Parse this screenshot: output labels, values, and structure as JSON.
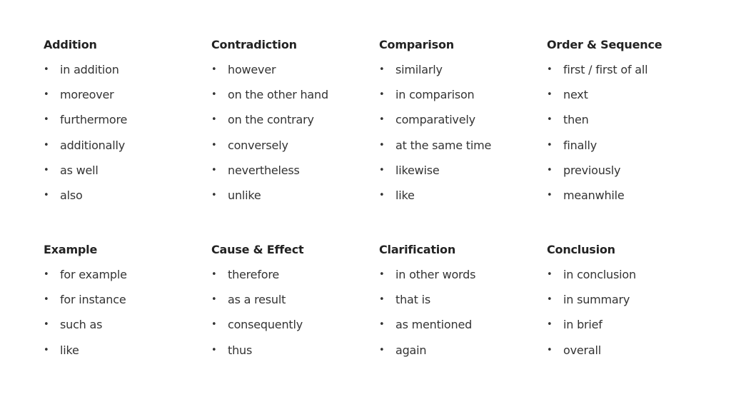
{
  "groups": [
    {
      "title": "Addition",
      "items": [
        "in addition",
        "moreover",
        "furthermore",
        "additionally",
        "as well",
        "also"
      ]
    },
    {
      "title": "Contradiction",
      "items": [
        "however",
        "on the other hand",
        "on the contrary",
        "conversely",
        "nevertheless",
        "unlike"
      ]
    },
    {
      "title": "Comparison",
      "items": [
        "similarly",
        "in comparison",
        "comparatively",
        "at the same time",
        "likewise",
        "like"
      ]
    },
    {
      "title": "Order & Sequence",
      "items": [
        "first / first of all",
        "next",
        "then",
        "finally",
        "previously",
        "meanwhile"
      ]
    },
    {
      "title": "Example",
      "items": [
        "for example",
        "for instance",
        "such as",
        "like"
      ]
    },
    {
      "title": "Cause & Effect",
      "items": [
        "therefore",
        "as a result",
        "consequently",
        "thus"
      ]
    },
    {
      "title": "Clarification",
      "items": [
        "in other words",
        "that is",
        "as mentioned",
        "again"
      ]
    },
    {
      "title": "Conclusion",
      "items": [
        "in conclusion",
        "in summary",
        "in brief",
        "overall"
      ]
    }
  ],
  "bullet_glyph": "•"
}
